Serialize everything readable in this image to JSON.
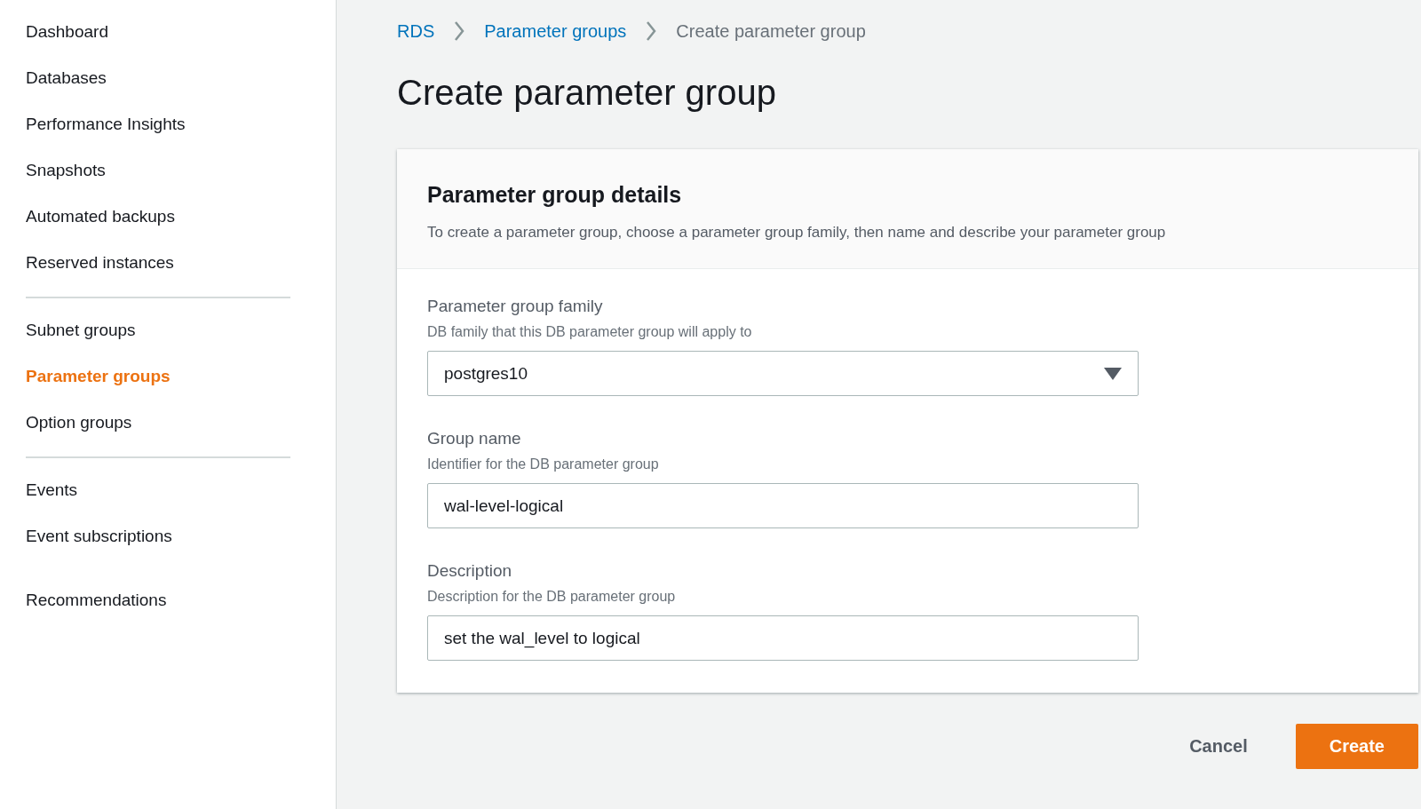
{
  "sidebar": {
    "sections": [
      {
        "divider": true,
        "items": [
          {
            "label": "Dashboard",
            "selected": false
          },
          {
            "label": "Databases",
            "selected": false
          },
          {
            "label": "Performance Insights",
            "selected": false
          },
          {
            "label": "Snapshots",
            "selected": false
          },
          {
            "label": "Automated backups",
            "selected": false
          },
          {
            "label": "Reserved instances",
            "selected": false
          }
        ]
      },
      {
        "divider": true,
        "items": [
          {
            "label": "Subnet groups",
            "selected": false
          },
          {
            "label": "Parameter groups",
            "selected": true
          },
          {
            "label": "Option groups",
            "selected": false
          }
        ]
      },
      {
        "divider": false,
        "items": [
          {
            "label": "Events",
            "selected": false
          },
          {
            "label": "Event subscriptions",
            "selected": false
          }
        ]
      },
      {
        "divider": false,
        "items": [
          {
            "label": "Recommendations",
            "selected": false
          }
        ]
      }
    ]
  },
  "breadcrumbs": [
    {
      "label": "RDS",
      "link": true
    },
    {
      "label": "Parameter groups",
      "link": true
    },
    {
      "label": "Create parameter group",
      "link": false
    }
  ],
  "title": "Create parameter group",
  "card": {
    "title": "Parameter group details",
    "description": "To create a parameter group, choose a parameter group family, then name and describe your parameter group",
    "fields": [
      {
        "kind": "select",
        "label": "Parameter group family",
        "hint": "DB family that this DB parameter group will apply to",
        "value": "postgres10"
      },
      {
        "kind": "text",
        "label": "Group name",
        "hint": "Identifier for the DB parameter group",
        "value": "wal-level-logical"
      },
      {
        "kind": "text",
        "label": "Description",
        "hint": "Description for the DB parameter group",
        "value": "set the wal_level to logical"
      }
    ]
  },
  "buttons": [
    {
      "label": "Cancel",
      "primary": false
    },
    {
      "label": "Create",
      "primary": true
    }
  ]
}
